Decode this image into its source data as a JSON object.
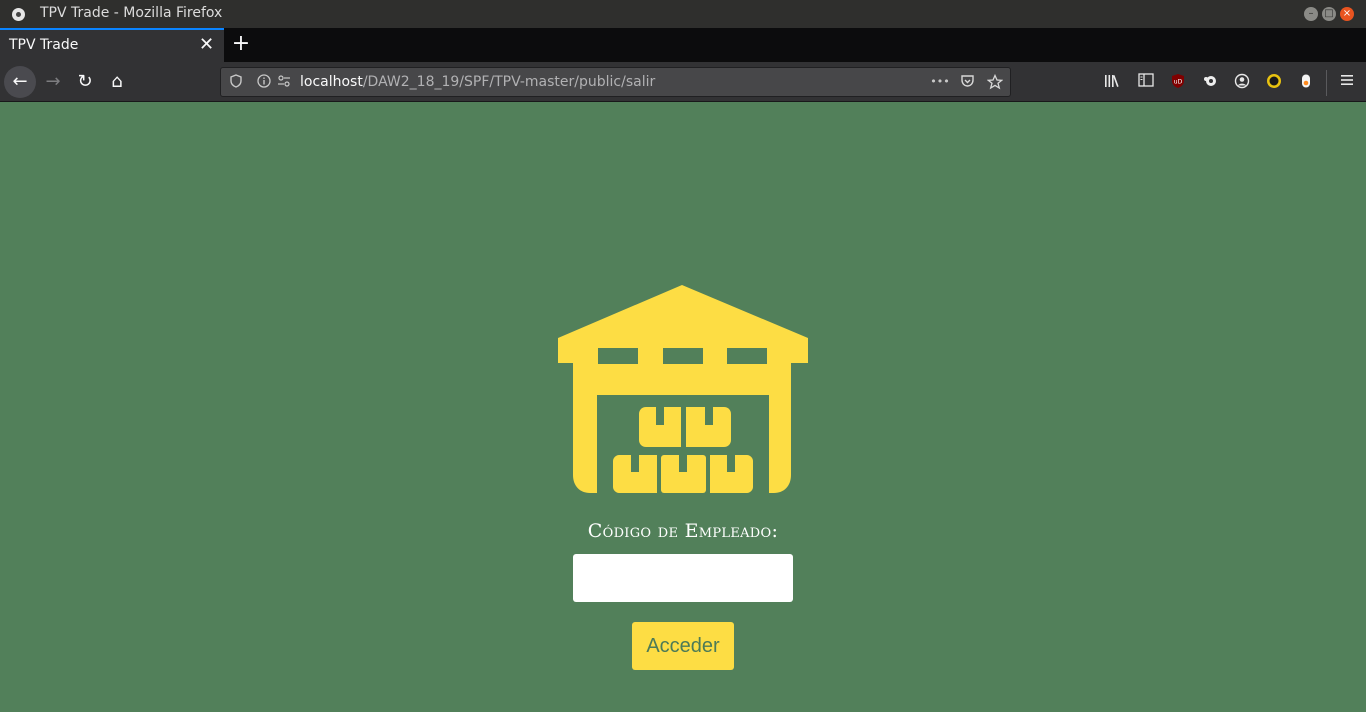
{
  "window": {
    "title": "TPV Trade - Mozilla Firefox"
  },
  "tab": {
    "label": "TPV Trade",
    "close_glyph": "✕"
  },
  "newtab_glyph": "+",
  "nav": {
    "back_glyph": "←",
    "forward_glyph": "→",
    "reload_glyph": "↻",
    "home_glyph": "⌂",
    "url_host": "localhost",
    "url_path": "/DAW2_18_19/SPF/TPV-master/public/salir",
    "more_glyph": "•••"
  },
  "page": {
    "icon": "warehouse-icon",
    "field_label": "Código de Empleado:",
    "code_value": "",
    "submit_label": "Acceder"
  },
  "colors": {
    "page_bg": "#52805a",
    "accent_yellow": "#fddd44",
    "button_text": "#4d7b57"
  }
}
